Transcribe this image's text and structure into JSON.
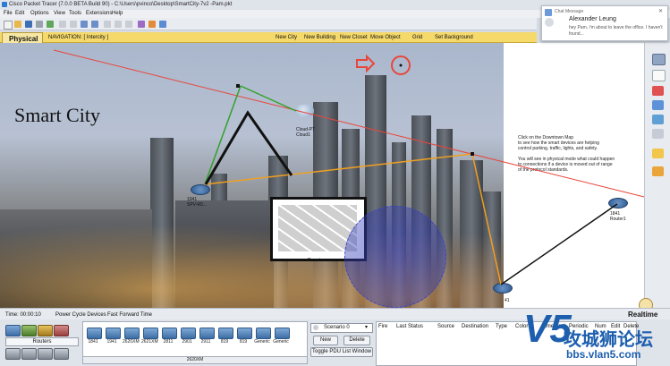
{
  "window": {
    "title": "Cisco Packet Tracer (7.0.0 BETA Build 90) - C:\\Users\\pvinco\\Desktop\\SmartCity-7v2 -Pam.pkt"
  },
  "menu": [
    "File",
    "Edit",
    "Options",
    "View",
    "Tools",
    "Extensions",
    "Help"
  ],
  "navbar": {
    "tab_label": "Physical",
    "navigation": "NAVIGATION:  [ Intercity ]",
    "items": [
      "New City",
      "New Building",
      "New Closet",
      "Move Object",
      "Grid",
      "Set Background"
    ]
  },
  "workspace": {
    "heading": "Smart City",
    "labels": {
      "cloud": "Cloud-PT\nCloud1",
      "router_left": "1941\nSPV-R0...",
      "router_right": "1841\nRouter1",
      "router_bottom": "41",
      "area": "Downtown"
    },
    "notes": [
      "Click on the Downtown Map",
      "to see how the smart devices are helping",
      "control parking, traffic, lights, and safety.",
      "",
      "You will see in physical mode what could happen",
      "to connections if a device is moved out of range",
      "of the protocol standards."
    ]
  },
  "chat": {
    "header": "Chat Message",
    "sender": "Alexander Leung",
    "preview": "hey Pam, i'm about to leave the office. I haven't found..."
  },
  "statusbar": {
    "time": "Time: 00:00:10",
    "power_cycle": "Power Cycle Devices",
    "fast_forward": "Fast Forward Time",
    "mode": "Realtime"
  },
  "bottom": {
    "category_label": "Routers",
    "devices": [
      "1841",
      "1941",
      "2620XM",
      "2621XM",
      "2811",
      "2901",
      "2911",
      "819",
      "819",
      "Generic",
      "Generic"
    ],
    "selected_device": "2620XM",
    "scenario": "Scenario 0",
    "new_label": "New",
    "delete_label": "Delete",
    "toggle_label": "Toggle PDU List Window",
    "pdu_columns": [
      "Fire",
      "Last Status",
      "Source",
      "Destination",
      "Type",
      "Color",
      "Time(sec)",
      "Periodic",
      "Num",
      "Edit",
      "Delete"
    ]
  },
  "watermark": {
    "line1": "V5",
    "line2": "攻城狮论坛",
    "line3": "bbs.vlan5.com"
  },
  "colors": {
    "navbar": "#f5d96a",
    "link_red": "#e8463a",
    "link_green": "#33a02c",
    "link_orange": "#f0a020",
    "link_black": "#111111"
  }
}
